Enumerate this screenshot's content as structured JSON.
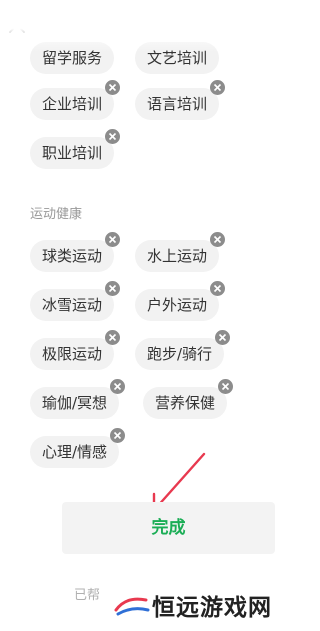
{
  "window": {
    "close_icon": "close-icon"
  },
  "top_chips": [
    {
      "label": "留学服务"
    },
    {
      "label": "文艺培训"
    }
  ],
  "education_chips": [
    {
      "label": "企业培训"
    },
    {
      "label": "语言培训"
    },
    {
      "label": "职业培训"
    }
  ],
  "section": {
    "title": "运动健康"
  },
  "sports_chips": [
    {
      "label": "球类运动"
    },
    {
      "label": "水上运动"
    },
    {
      "label": "冰雪运动"
    },
    {
      "label": "户外运动"
    },
    {
      "label": "极限运动"
    },
    {
      "label": "跑步/骑行"
    },
    {
      "label": "瑜伽/冥想"
    },
    {
      "label": "营养保健"
    },
    {
      "label": "心理/情感"
    }
  ],
  "actions": {
    "done_label": "完成"
  },
  "footer": {
    "text": "已帮"
  },
  "watermark": {
    "text": "恒远游戏网"
  },
  "colors": {
    "accent": "#1aad55",
    "chip_bg": "#f2f2f2",
    "badge": "#8c8c8c",
    "arrow": "#e8394f"
  }
}
